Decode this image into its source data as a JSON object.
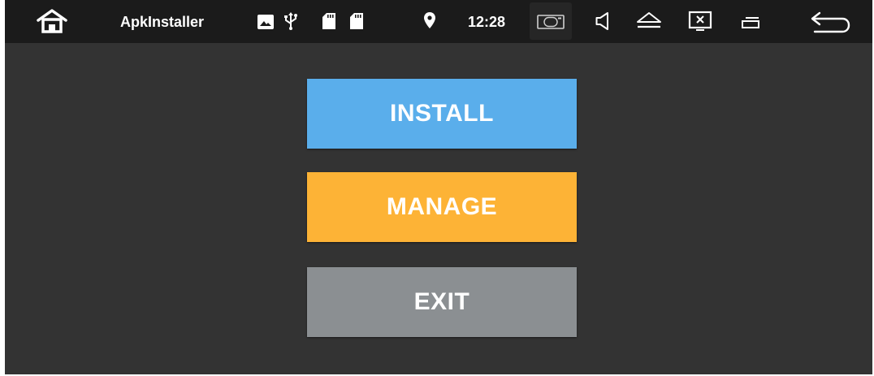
{
  "statusbar": {
    "app_title": "ApkInstaller",
    "time": "12:28",
    "icons": {
      "home": "home-icon",
      "image": "image-icon",
      "usb": "usb-icon",
      "sd_card_1": "sd-card-icon",
      "sd_card_2": "sd-card-icon",
      "location": "location-pin-icon",
      "camera": "camera-icon",
      "volume": "speaker-icon",
      "eject": "eject-icon",
      "screen_off": "screen-close-icon",
      "recent_apps": "recent-apps-icon",
      "back": "back-arrow-icon"
    }
  },
  "main": {
    "install_label": "INSTALL",
    "manage_label": "MANAGE",
    "exit_label": "EXIT"
  },
  "colors": {
    "statusbar_bg": "#1b1b1b",
    "background": "#333333",
    "install": "#5aaeeb",
    "manage": "#fdb336",
    "exit": "#8b8f92",
    "text": "#ffffff"
  }
}
